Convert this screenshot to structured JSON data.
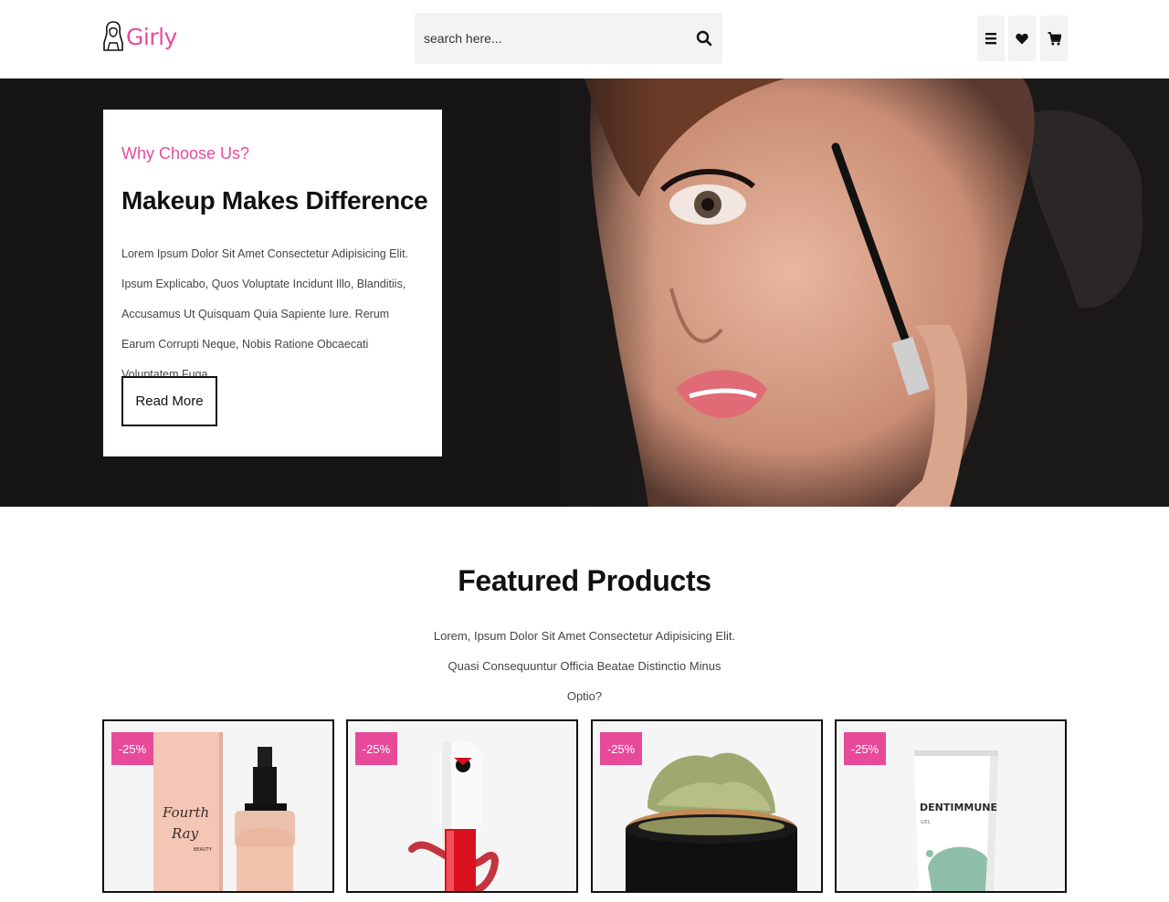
{
  "header": {
    "logo_text": "Girly",
    "search": {
      "placeholder": "search here..."
    }
  },
  "hero": {
    "subtitle": "Why Choose Us?",
    "title": "Makeup Makes Difference",
    "text": "Lorem Ipsum Dolor Sit Amet Consectetur Adipisicing Elit. Ipsum Explicabo, Quos Voluptate Incidunt Illo, Blanditiis, Accusamus Ut Quisquam Quia Sapiente Iure. Rerum Earum Corrupti Neque, Nobis Ratione Obcaecati Voluptatem Fuga.",
    "button_label": "Read More"
  },
  "featured": {
    "title": "Featured Products",
    "text": "Lorem, Ipsum Dolor Sit Amet Consectetur Adipisicing Elit. Quasi Consequuntur Officia Beatae Distinctio Minus Optio?",
    "products": [
      {
        "discount": "-25%",
        "image_icon": "foundation-bottle-icon",
        "package_lines": [
          "Fourth",
          "Ray",
          "BEAUTY"
        ]
      },
      {
        "discount": "-25%",
        "image_icon": "lipstick-icon"
      },
      {
        "discount": "-25%",
        "image_icon": "powder-jar-icon"
      },
      {
        "discount": "-25%",
        "image_icon": "cream-tube-icon",
        "package_lines": [
          "DENTIMMUNE",
          "GEL"
        ]
      }
    ]
  },
  "colors": {
    "accent": "#e84a9a",
    "hero_bg": "#161414",
    "text": "#111111"
  }
}
